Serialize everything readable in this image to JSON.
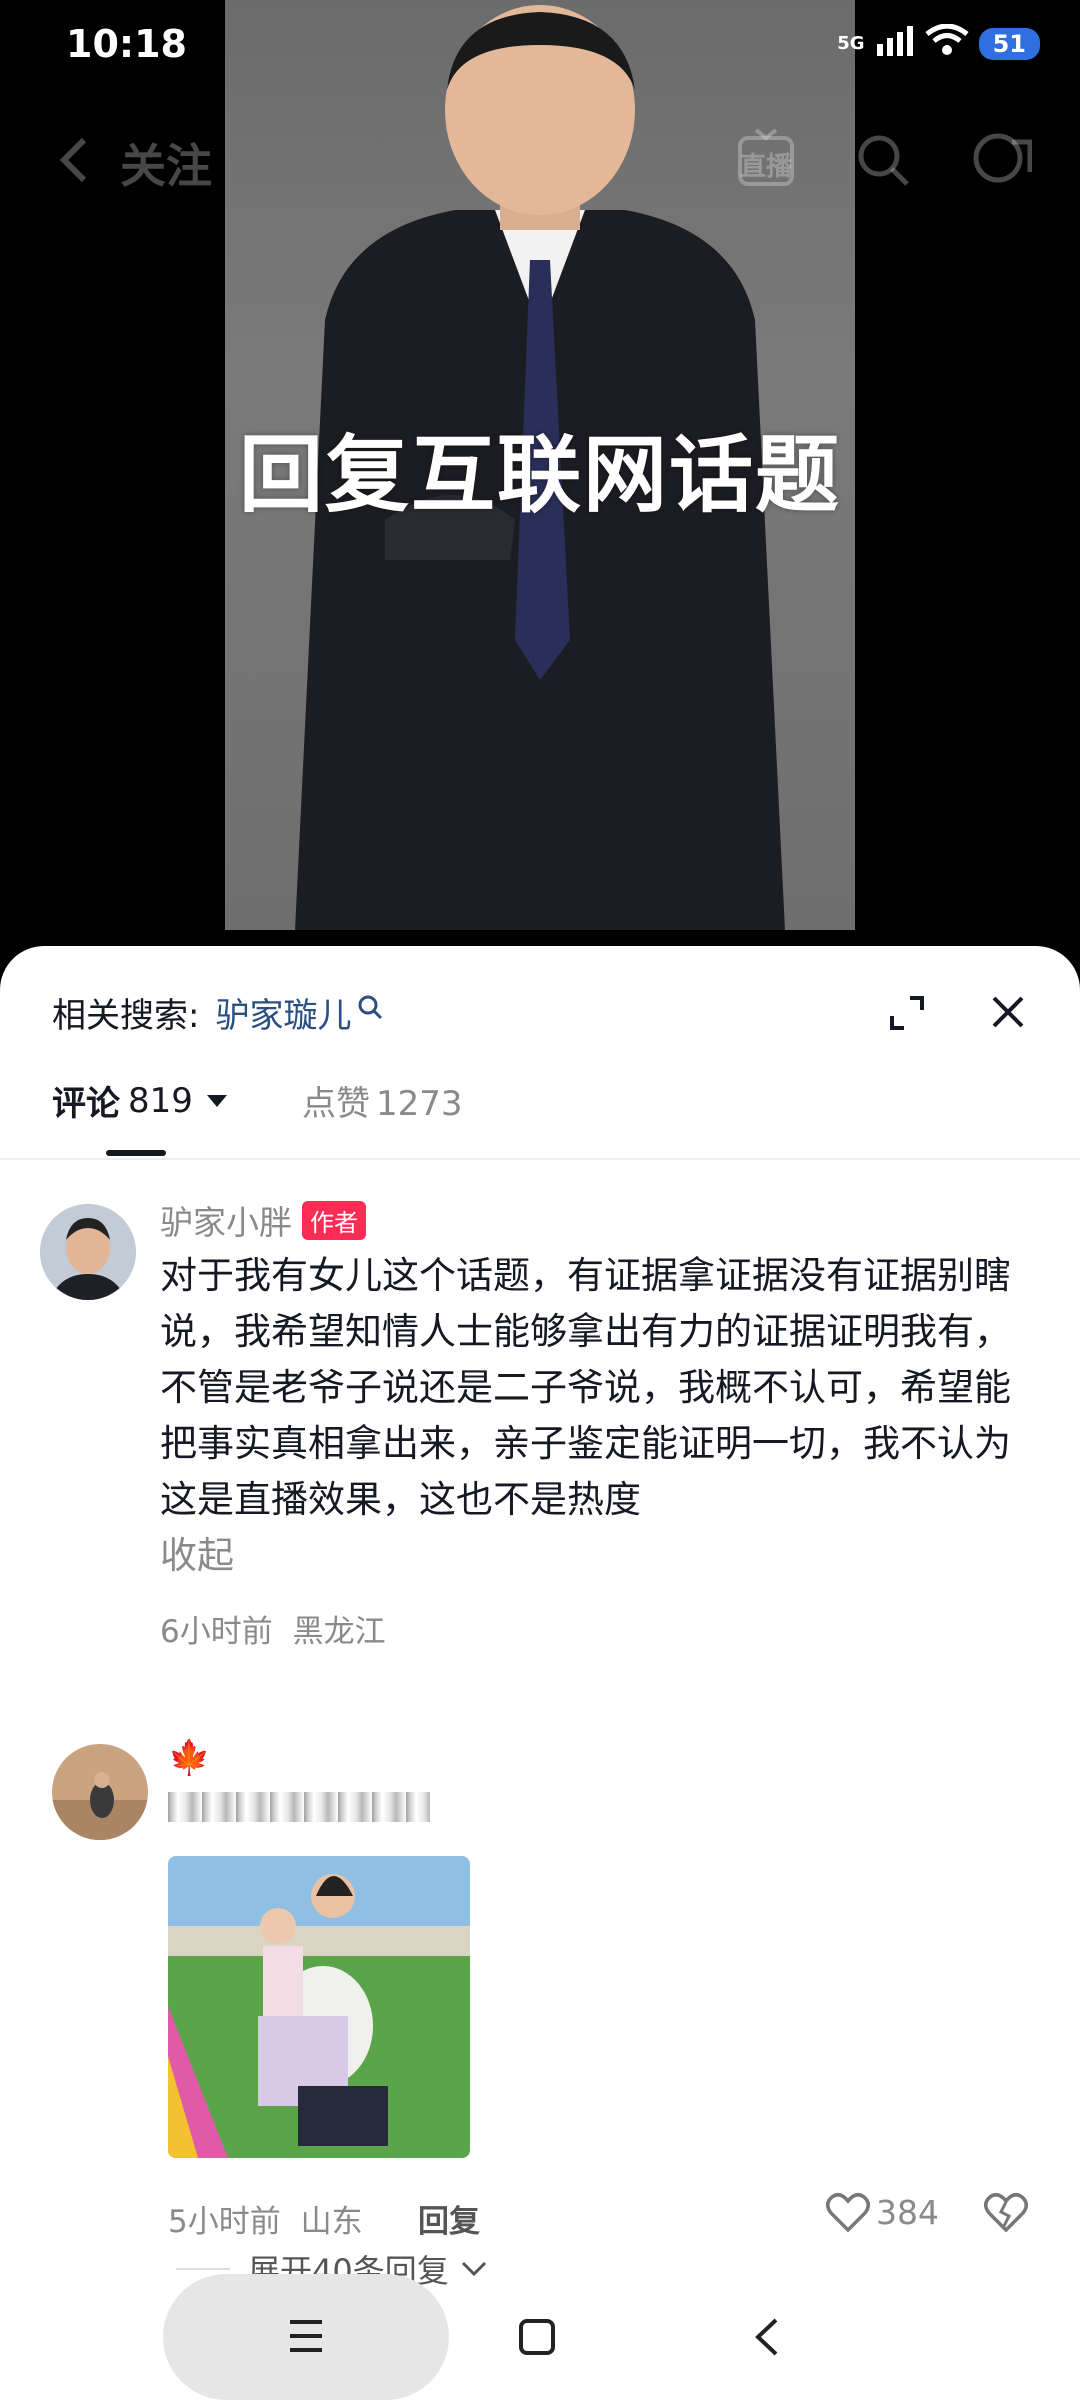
{
  "status_bar": {
    "time": "10:18",
    "network": "5G",
    "battery": "51"
  },
  "nav": {
    "back_label": "关注",
    "live_label": "直播"
  },
  "video": {
    "caption": "回复互联网话题"
  },
  "sheet": {
    "related_search_label": "相关搜索:",
    "related_search_term": "驴家璇儿",
    "tabs": {
      "comments_label": "评论",
      "comments_count": "819",
      "likes_label": "点赞",
      "likes_count": "1273"
    }
  },
  "comments": [
    {
      "username": "驴家小胖",
      "badge": "作者",
      "text": "对于我有女儿这个话题，有证据拿证据没有证据别瞎说，我希望知情人士能够拿出有力的证据证明我有，不管是老爷子说还是二子爷说，我概不认可，希望能把事实真相拿出来，亲子鉴定能证明一切，我不认为这是直播效果，这也不是热度",
      "collapse_label": "收起",
      "time": "6小时前",
      "location": "黑龙江"
    },
    {
      "username": "🍁",
      "time": "5小时前",
      "location": "山东",
      "reply_label": "回复",
      "like_count": "384",
      "expand_label": "展开40条回复"
    }
  ]
}
